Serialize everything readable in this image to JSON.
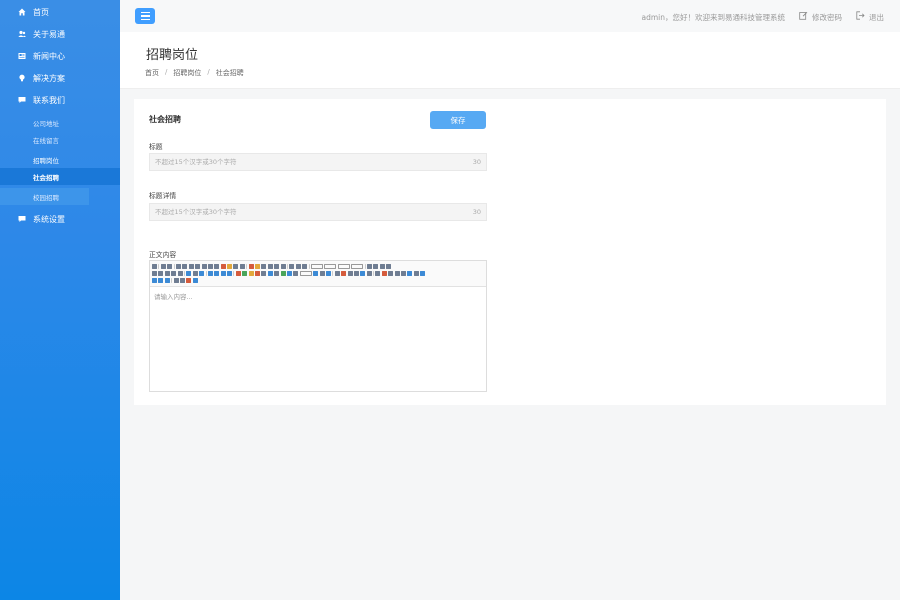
{
  "sidebar": {
    "items": [
      {
        "label": "首页",
        "icon": "home-icon"
      },
      {
        "label": "关于易通",
        "icon": "users-icon"
      },
      {
        "label": "新闻中心",
        "icon": "news-icon"
      },
      {
        "label": "解决方案",
        "icon": "bulb-icon"
      },
      {
        "label": "联系我们",
        "icon": "chat-icon"
      }
    ],
    "subitems": [
      {
        "label": "公司地址"
      },
      {
        "label": "在线留言"
      },
      {
        "label": "招聘岗位"
      },
      {
        "label": "社会招聘"
      },
      {
        "label": "校园招聘"
      }
    ],
    "settings": {
      "label": "系统设置",
      "icon": "chat-icon"
    }
  },
  "header": {
    "greeting": "admin，您好！欢迎来到易通科技管理系统",
    "change_password": "修改密码",
    "logout": "退出"
  },
  "page": {
    "title": "招聘岗位",
    "breadcrumb": [
      "首页",
      "招聘岗位",
      "社会招聘"
    ]
  },
  "form": {
    "card_title": "社会招聘",
    "save_label": "保存",
    "title_label": "标题",
    "title_placeholder": "不超过15个汉字或30个字符",
    "title_counter": "30",
    "detail_label": "标题详情",
    "detail_placeholder": "不超过15个汉字或30个字符",
    "detail_counter": "30",
    "content_label": "正文内容",
    "editor_placeholder": "请输入内容..."
  },
  "colors": {
    "accent": "#409eff",
    "sidebar": "#2d88e8",
    "active_item": "#1a78d8"
  }
}
